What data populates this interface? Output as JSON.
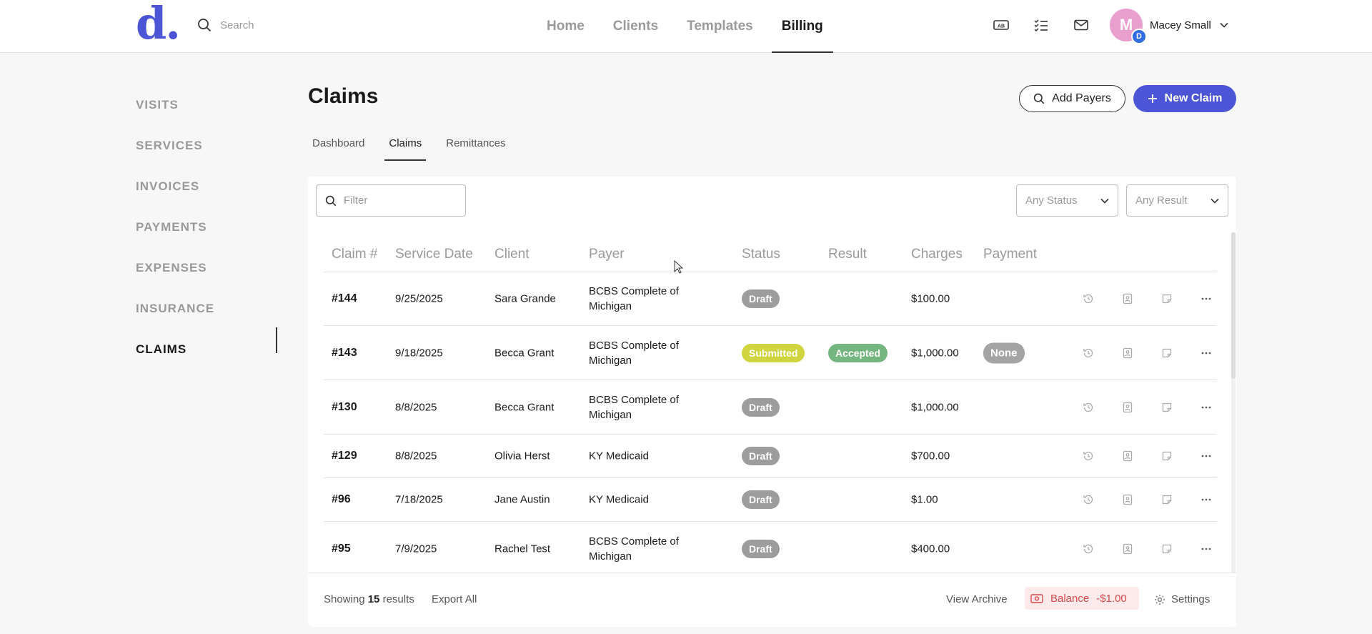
{
  "header": {
    "logo": "d.",
    "search_placeholder": "Search",
    "nav": [
      "Home",
      "Clients",
      "Templates",
      "Billing"
    ],
    "active_nav": "Billing",
    "user": {
      "initial": "M",
      "badge": "D",
      "name": "Macey Small",
      "avatar_color": "#e9a0cf"
    },
    "icons": [
      "ab-card-icon",
      "checklist-icon",
      "mail-icon"
    ]
  },
  "sidebar": {
    "items": [
      "VISITS",
      "SERVICES",
      "INVOICES",
      "PAYMENTS",
      "EXPENSES",
      "INSURANCE",
      "CLAIMS"
    ],
    "active": "CLAIMS"
  },
  "page": {
    "title": "Claims",
    "add_payers_label": "Add Payers",
    "new_claim_label": "New Claim",
    "tabs": [
      "Dashboard",
      "Claims",
      "Remittances"
    ],
    "active_tab": "Claims"
  },
  "toolbar": {
    "filter_placeholder": "Filter",
    "status_select": "Any Status",
    "result_select": "Any Result"
  },
  "table": {
    "columns": [
      "Claim #",
      "Service Date",
      "Client",
      "Payer",
      "Status",
      "Result",
      "Charges",
      "Payment"
    ],
    "rows": [
      {
        "claim": "#144",
        "date": "9/25/2025",
        "client": "Sara Grande",
        "payer": "BCBS Complete of Michigan",
        "status": "Draft",
        "result": "",
        "charges": "$100.00",
        "payment": ""
      },
      {
        "claim": "#143",
        "date": "9/18/2025",
        "client": "Becca Grant",
        "payer": "BCBS Complete of Michigan",
        "status": "Submitted",
        "result": "Accepted",
        "charges": "$1,000.00",
        "payment": "None"
      },
      {
        "claim": "#130",
        "date": "8/8/2025",
        "client": "Becca Grant",
        "payer": "BCBS Complete of Michigan",
        "status": "Draft",
        "result": "",
        "charges": "$1,000.00",
        "payment": ""
      },
      {
        "claim": "#129",
        "date": "8/8/2025",
        "client": "Olivia Herst",
        "payer": "KY Medicaid",
        "status": "Draft",
        "result": "",
        "charges": "$700.00",
        "payment": ""
      },
      {
        "claim": "#96",
        "date": "7/18/2025",
        "client": "Jane Austin",
        "payer": "KY Medicaid",
        "status": "Draft",
        "result": "",
        "charges": "$1.00",
        "payment": ""
      },
      {
        "claim": "#95",
        "date": "7/9/2025",
        "client": "Rachel Test",
        "payer": "BCBS Complete of Michigan",
        "status": "Draft",
        "result": "",
        "charges": "$400.00",
        "payment": ""
      }
    ],
    "row_actions": [
      "history-icon",
      "client-file-icon",
      "note-icon",
      "more-icon"
    ]
  },
  "footer": {
    "showing_prefix": "Showing",
    "count": "15",
    "showing_suffix": "results",
    "export_label": "Export All",
    "archive_label": "View Archive",
    "balance_label": "Balance",
    "balance_value": "-$1.00",
    "settings_label": "Settings"
  },
  "colors": {
    "brand": "#4b55d6",
    "draft": "#9d9d9d",
    "submitted": "#cfd43f",
    "accepted": "#75b57f",
    "balance": "#d84a4a"
  }
}
